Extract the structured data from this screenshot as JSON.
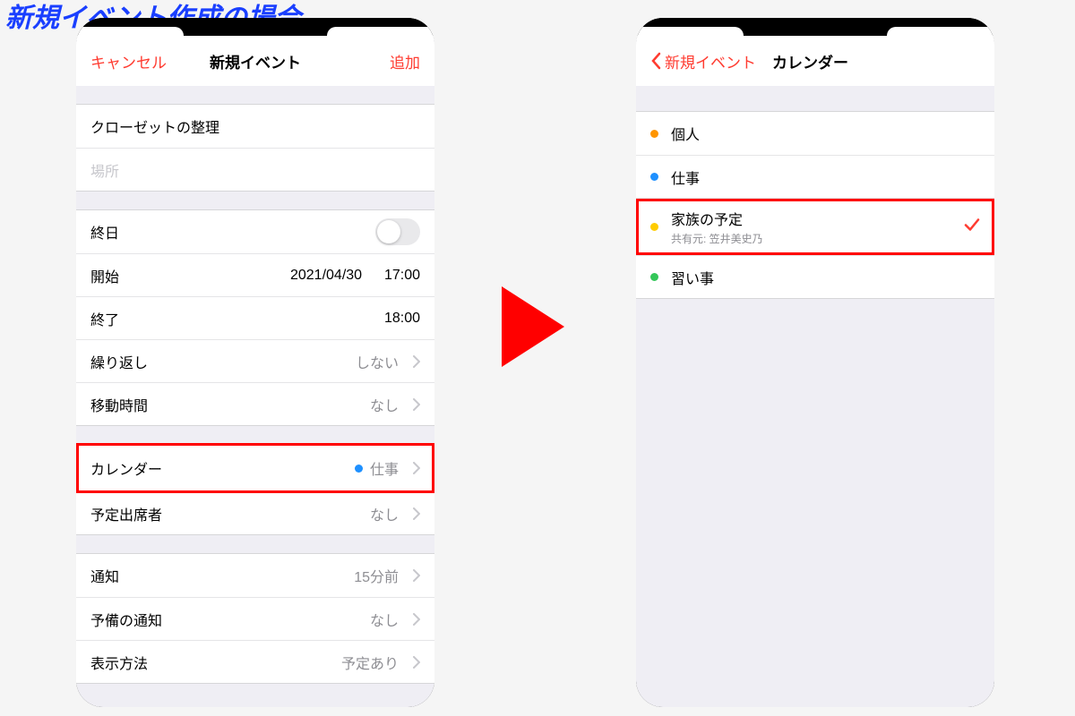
{
  "heading": "新規イベント作成の場合",
  "left": {
    "nav": {
      "cancel": "キャンセル",
      "title": "新規イベント",
      "add": "追加"
    },
    "title_field": "クローゼットの整理",
    "location_placeholder": "場所",
    "allday": {
      "label": "終日"
    },
    "start": {
      "label": "開始",
      "date": "2021/04/30",
      "time": "17:00"
    },
    "end": {
      "label": "終了",
      "time": "18:00"
    },
    "repeat": {
      "label": "繰り返し",
      "value": "しない"
    },
    "travel": {
      "label": "移動時間",
      "value": "なし"
    },
    "calendar": {
      "label": "カレンダー",
      "value": "仕事",
      "dot": "#1e90ff"
    },
    "invitees": {
      "label": "予定出席者",
      "value": "なし"
    },
    "alert": {
      "label": "通知",
      "value": "15分前"
    },
    "alert2": {
      "label": "予備の通知",
      "value": "なし"
    },
    "showas": {
      "label": "表示方法",
      "value": "予定あり"
    }
  },
  "right": {
    "nav": {
      "back": "新規イベント",
      "title": "カレンダー"
    },
    "calendars": [
      {
        "name": "個人",
        "dot": "#ff9500"
      },
      {
        "name": "仕事",
        "dot": "#1e90ff"
      },
      {
        "name": "家族の予定",
        "sub": "共有元: 笠井美史乃",
        "dot": "#ffcc00",
        "checked": true,
        "highlight": true
      },
      {
        "name": "習い事",
        "dot": "#34c759"
      }
    ]
  }
}
